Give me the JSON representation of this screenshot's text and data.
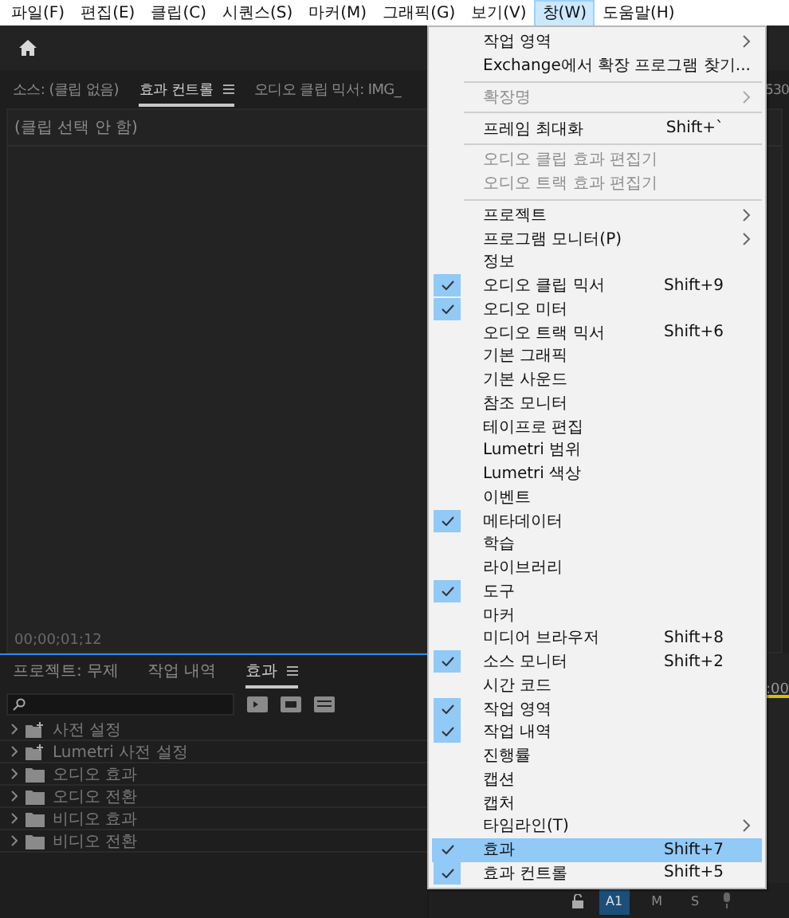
{
  "menubar": [
    {
      "label": "파일(F)",
      "selected": false
    },
    {
      "label": "편집(E)",
      "selected": false
    },
    {
      "label": "클립(C)",
      "selected": false
    },
    {
      "label": "시퀀스(S)",
      "selected": false
    },
    {
      "label": "마커(M)",
      "selected": false
    },
    {
      "label": "그래픽(G)",
      "selected": false
    },
    {
      "label": "보기(V)",
      "selected": false
    },
    {
      "label": "창(W)",
      "selected": true
    },
    {
      "label": "도움말(H)",
      "selected": false
    }
  ],
  "top_panel": {
    "tabs": [
      {
        "label": "소스: (클립 없음)",
        "selected": false
      },
      {
        "label": "효과 컨트롤",
        "selected": true
      },
      {
        "label": "오디오 클립 믹서: IMG_",
        "selected": false
      }
    ],
    "right_fragment": "530",
    "message": "(클립 선택 안 함)",
    "timecode": "00;00;01;12"
  },
  "bottom_panel": {
    "tabs": [
      {
        "label": "프로젝트: 무제",
        "selected": false
      },
      {
        "label": "작업 내역",
        "selected": false
      },
      {
        "label": "효과",
        "selected": true
      }
    ],
    "tree": [
      {
        "label": "사전 설정",
        "kind": "preset"
      },
      {
        "label": "Lumetri 사전 설정",
        "kind": "preset"
      },
      {
        "label": "오디오 효과",
        "kind": "folder"
      },
      {
        "label": "오디오 전환",
        "kind": "folder"
      },
      {
        "label": "비디오 효과",
        "kind": "folder"
      },
      {
        "label": "비디오 전환",
        "kind": "folder"
      }
    ]
  },
  "timeline": {
    "ruler_fragment": ":00",
    "track_buttons": [
      {
        "label": "A1",
        "selected": true
      },
      {
        "label": "M",
        "selected": false
      },
      {
        "label": "S",
        "selected": false
      }
    ]
  },
  "menu": [
    {
      "kind": "item",
      "label": "작업 영역",
      "submenu": true,
      "disabled": false,
      "checked": false,
      "selected": false
    },
    {
      "kind": "item",
      "label": "Exchange에서 확장 프로그램 찾기...",
      "disabled": false,
      "checked": false,
      "selected": false
    },
    {
      "kind": "separator"
    },
    {
      "kind": "item",
      "label": "확장명",
      "submenu": true,
      "disabled": true,
      "checked": false,
      "selected": false
    },
    {
      "kind": "separator"
    },
    {
      "kind": "item",
      "label": "프레임 최대화",
      "shortcut": "Shift+`",
      "disabled": false,
      "checked": false,
      "selected": false
    },
    {
      "kind": "separator"
    },
    {
      "kind": "item",
      "label": "오디오 클립 효과 편집기",
      "disabled": true,
      "checked": false,
      "selected": false
    },
    {
      "kind": "item",
      "label": "오디오 트랙 효과 편집기",
      "disabled": true,
      "checked": false,
      "selected": false
    },
    {
      "kind": "separator"
    },
    {
      "kind": "item",
      "label": "프로젝트",
      "submenu": true,
      "disabled": false,
      "checked": false,
      "selected": false
    },
    {
      "kind": "item",
      "label": "프로그램 모니터(P)",
      "submenu": true,
      "disabled": false,
      "checked": false,
      "selected": false
    },
    {
      "kind": "item",
      "label": "정보",
      "disabled": false,
      "checked": false,
      "selected": false
    },
    {
      "kind": "item",
      "label": "오디오 클립 믹서",
      "shortcut": "Shift+9",
      "disabled": false,
      "checked": true,
      "selected": false
    },
    {
      "kind": "item",
      "label": "오디오 미터",
      "disabled": false,
      "checked": true,
      "selected": false
    },
    {
      "kind": "item",
      "label": "오디오 트랙 믹서",
      "shortcut": "Shift+6",
      "disabled": false,
      "checked": false,
      "selected": false
    },
    {
      "kind": "item",
      "label": "기본 그래픽",
      "disabled": false,
      "checked": false,
      "selected": false
    },
    {
      "kind": "item",
      "label": "기본 사운드",
      "disabled": false,
      "checked": false,
      "selected": false
    },
    {
      "kind": "item",
      "label": "참조 모니터",
      "disabled": false,
      "checked": false,
      "selected": false
    },
    {
      "kind": "item",
      "label": "테이프로 편집",
      "disabled": false,
      "checked": false,
      "selected": false
    },
    {
      "kind": "item",
      "label": "Lumetri 범위",
      "disabled": false,
      "checked": false,
      "selected": false
    },
    {
      "kind": "item",
      "label": "Lumetri 색상",
      "disabled": false,
      "checked": false,
      "selected": false
    },
    {
      "kind": "item",
      "label": "이벤트",
      "disabled": false,
      "checked": false,
      "selected": false
    },
    {
      "kind": "item",
      "label": "메타데이터",
      "disabled": false,
      "checked": true,
      "selected": false
    },
    {
      "kind": "item",
      "label": "학습",
      "disabled": false,
      "checked": false,
      "selected": false
    },
    {
      "kind": "item",
      "label": "라이브러리",
      "disabled": false,
      "checked": false,
      "selected": false
    },
    {
      "kind": "item",
      "label": "도구",
      "disabled": false,
      "checked": true,
      "selected": false
    },
    {
      "kind": "item",
      "label": "마커",
      "disabled": false,
      "checked": false,
      "selected": false
    },
    {
      "kind": "item",
      "label": "미디어 브라우저",
      "shortcut": "Shift+8",
      "disabled": false,
      "checked": false,
      "selected": false
    },
    {
      "kind": "item",
      "label": "소스 모니터",
      "shortcut": "Shift+2",
      "disabled": false,
      "checked": true,
      "selected": false
    },
    {
      "kind": "item",
      "label": "시간 코드",
      "disabled": false,
      "checked": false,
      "selected": false
    },
    {
      "kind": "item",
      "label": "작업 영역",
      "disabled": false,
      "checked": true,
      "selected": false
    },
    {
      "kind": "item",
      "label": "작업 내역",
      "disabled": false,
      "checked": true,
      "selected": false
    },
    {
      "kind": "item",
      "label": "진행률",
      "disabled": false,
      "checked": false,
      "selected": false
    },
    {
      "kind": "item",
      "label": "캡션",
      "disabled": false,
      "checked": false,
      "selected": false
    },
    {
      "kind": "item",
      "label": "캡처",
      "disabled": false,
      "checked": false,
      "selected": false
    },
    {
      "kind": "item",
      "label": "타임라인(T)",
      "submenu": true,
      "disabled": false,
      "checked": false,
      "selected": false
    },
    {
      "kind": "item",
      "label": "효과",
      "shortcut": "Shift+7",
      "disabled": false,
      "checked": true,
      "selected": true
    },
    {
      "kind": "item",
      "label": "효과 컨트롤",
      "shortcut": "Shift+5",
      "disabled": false,
      "checked": true,
      "selected": false
    }
  ]
}
